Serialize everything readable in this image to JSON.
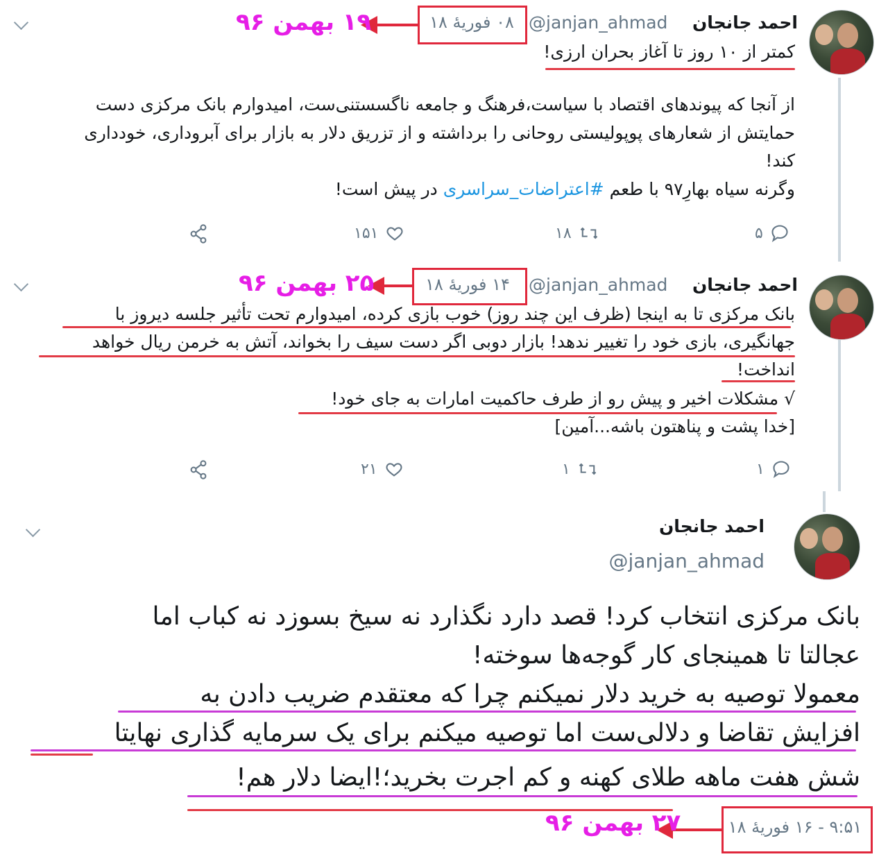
{
  "tweet1": {
    "name": "احمد جانجان",
    "handle": "@janjan_ahmad",
    "date": "۰۸ فوریهٔ ۱۸",
    "headline": "کمتر از ۱۰ روز تا آغاز بحران ارزی!",
    "line1": "از آنجا که پیوندهای اقتصاد با سیاست،فرهنگ و جامعه ناگسستنی‌ست، امیدوارم بانک مرکزی دست",
    "line2": "حمایتش از شعارهای پوپولیستی روحانی را برداشته و از تزریق دلار به بازار برای آبروداری، خودداری",
    "line3": "کند!",
    "line4_pre": "وگرنه سیاه بهارِ۹۷ با طعم ",
    "line4_hashtag": "#اعتراضات_سراسری",
    "line4_post": " در پیش است!",
    "replies": "۵",
    "retweets": "۱۸",
    "likes": "۱۵۱",
    "annotation": "۱۹ بهمن ۹۶"
  },
  "tweet2": {
    "name": "احمد جانجان",
    "handle": "@janjan_ahmad",
    "date": "۱۴ فوریهٔ ۱۸",
    "line1": "بانک مرکزی تا به اینجا (ظرف این چند روز) خوب بازی کرده، امیدوارم تحت تأثیر جلسه دیروز با",
    "line2": "جهانگیری، بازی خود را تغییر ندهد! بازار دوبی اگر دست سیف را بخواند، آتش به خرمن ریال خواهد",
    "line3": "انداخت!",
    "line4": "√ مشکلات اخیر و پیش رو از طرف حاکمیت امارات به جای خود!",
    "line5": "[خدا پشت و پناهتون باشه...آمین]",
    "replies": "۱",
    "retweets": "۱",
    "likes": "۲۱",
    "annotation": "۲۵ بهمن ۹۶"
  },
  "tweet3": {
    "name": "احمد جانجان",
    "handle": "@janjan_ahmad",
    "line1": "بانک مرکزی انتخاب کرد! قصد دارد نگذارد نه سیخ بسوزد نه کباب اما",
    "line2": "عجالتا تا همینجای کار گوجه‌ها سوخته!",
    "line3": "معمولا توصیه به خرید دلار نمیکنم چرا که معتقدم ضریب دادن به",
    "line4": "افزایش تقاضا و دلالی‌ست اما توصیه میکنم برای یک سرمایه گذاری نهایتا",
    "line5": "شش هفت ماهه طلای کهنه و کم اجرت بخرید؛!ایضا دلار هم!",
    "timestamp": "۹:۵۱ - ۱۶ فوریهٔ ۱۸",
    "annotation": "۲۷ بهمن ۹۶"
  },
  "colors": {
    "annotation_box": "#e0283c",
    "annotation_text": "#e61ee6",
    "hashtag": "#1b95e0",
    "meta": "#657786"
  }
}
